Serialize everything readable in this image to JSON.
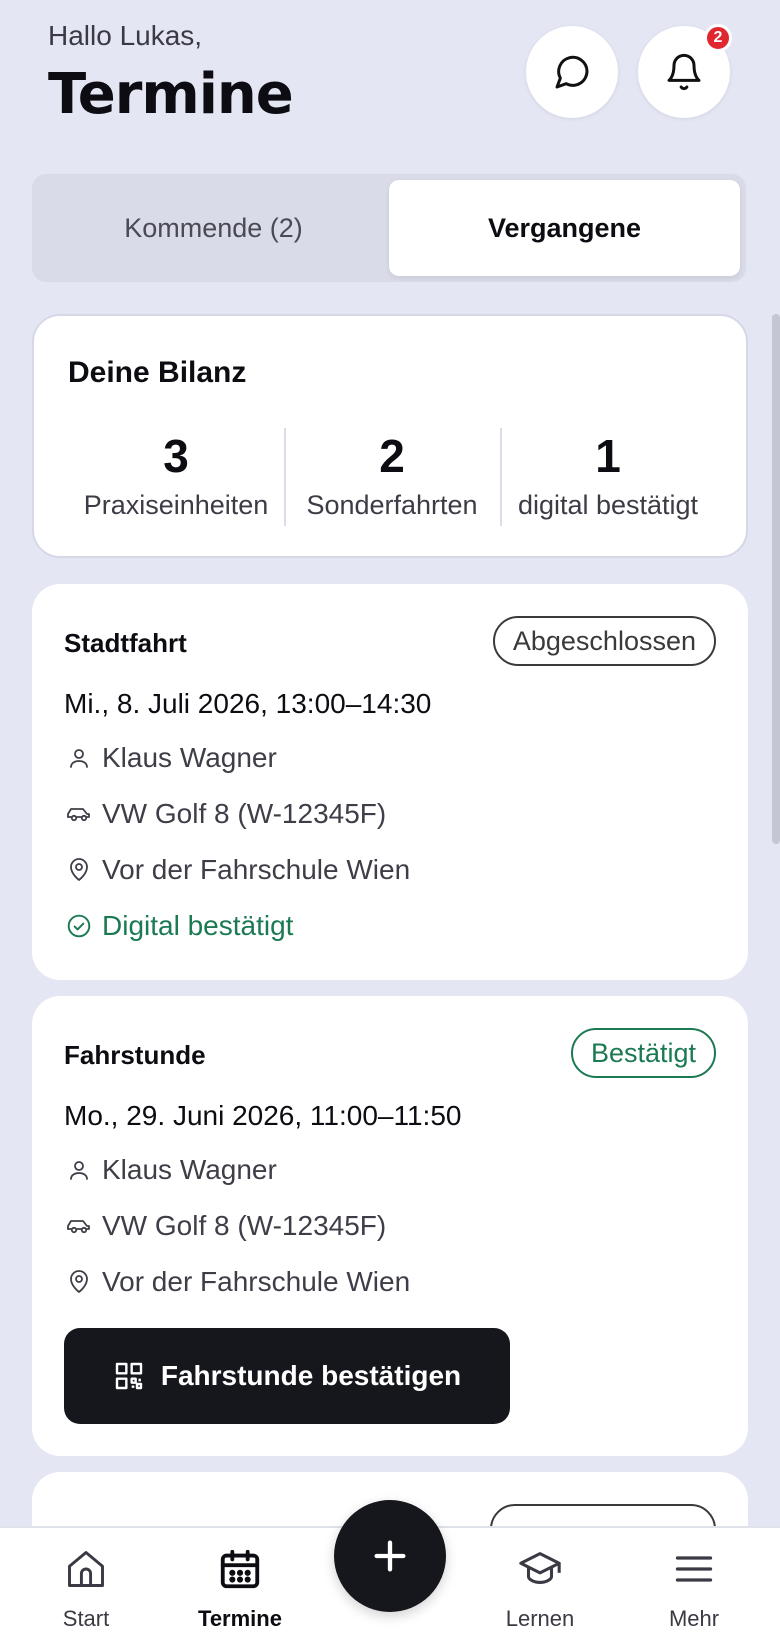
{
  "header": {
    "greeting": "Hallo Lukas,",
    "title": "Termine",
    "notification_count": "2",
    "icons": [
      "chat-icon",
      "bell-icon"
    ]
  },
  "tabs": [
    {
      "label": "Kommende (2)",
      "active": false
    },
    {
      "label": "Vergangene",
      "active": true
    }
  ],
  "balance": {
    "title": "Deine Bilanz",
    "stats": [
      {
        "value": "3",
        "label": "Praxiseinheiten"
      },
      {
        "value": "2",
        "label": "Sonderfahrten"
      },
      {
        "value": "1",
        "label": "digital bestätigt"
      }
    ]
  },
  "appointments": [
    {
      "type": "Stadtfahrt",
      "status": "Abgeschlossen",
      "date": "Mi., 8. Juli 2026, 13:00–14:30",
      "instructor": "Klaus Wagner",
      "vehicle": "VW Golf 8 (W-12345F)",
      "location": "Vor der Fahrschule Wien",
      "confirmation": "Digital bestätigt"
    },
    {
      "type": "Fahrstunde",
      "status": "Bestätigt",
      "date": "Mo., 29. Juni 2026, 11:00–11:50",
      "instructor": "Klaus Wagner",
      "vehicle": "VW Golf 8 (W-12345F)",
      "location": "Vor der Fahrschule Wien",
      "action_label": "Fahrstunde bestätigen"
    }
  ],
  "colors": {
    "background": "#e4e6f3",
    "accent_dark": "#15171c",
    "success_green": "#1c7a52",
    "badge_red": "#e0262f"
  },
  "bottom_nav": [
    {
      "label": "Start",
      "icon": "home-icon",
      "active": false
    },
    {
      "label": "Termine",
      "icon": "calendar-icon",
      "active": true
    },
    {
      "label": "Lernen",
      "icon": "graduation-cap-icon",
      "active": false
    },
    {
      "label": "Mehr",
      "icon": "menu-icon",
      "active": false
    }
  ],
  "fab_icon": "plus-icon"
}
